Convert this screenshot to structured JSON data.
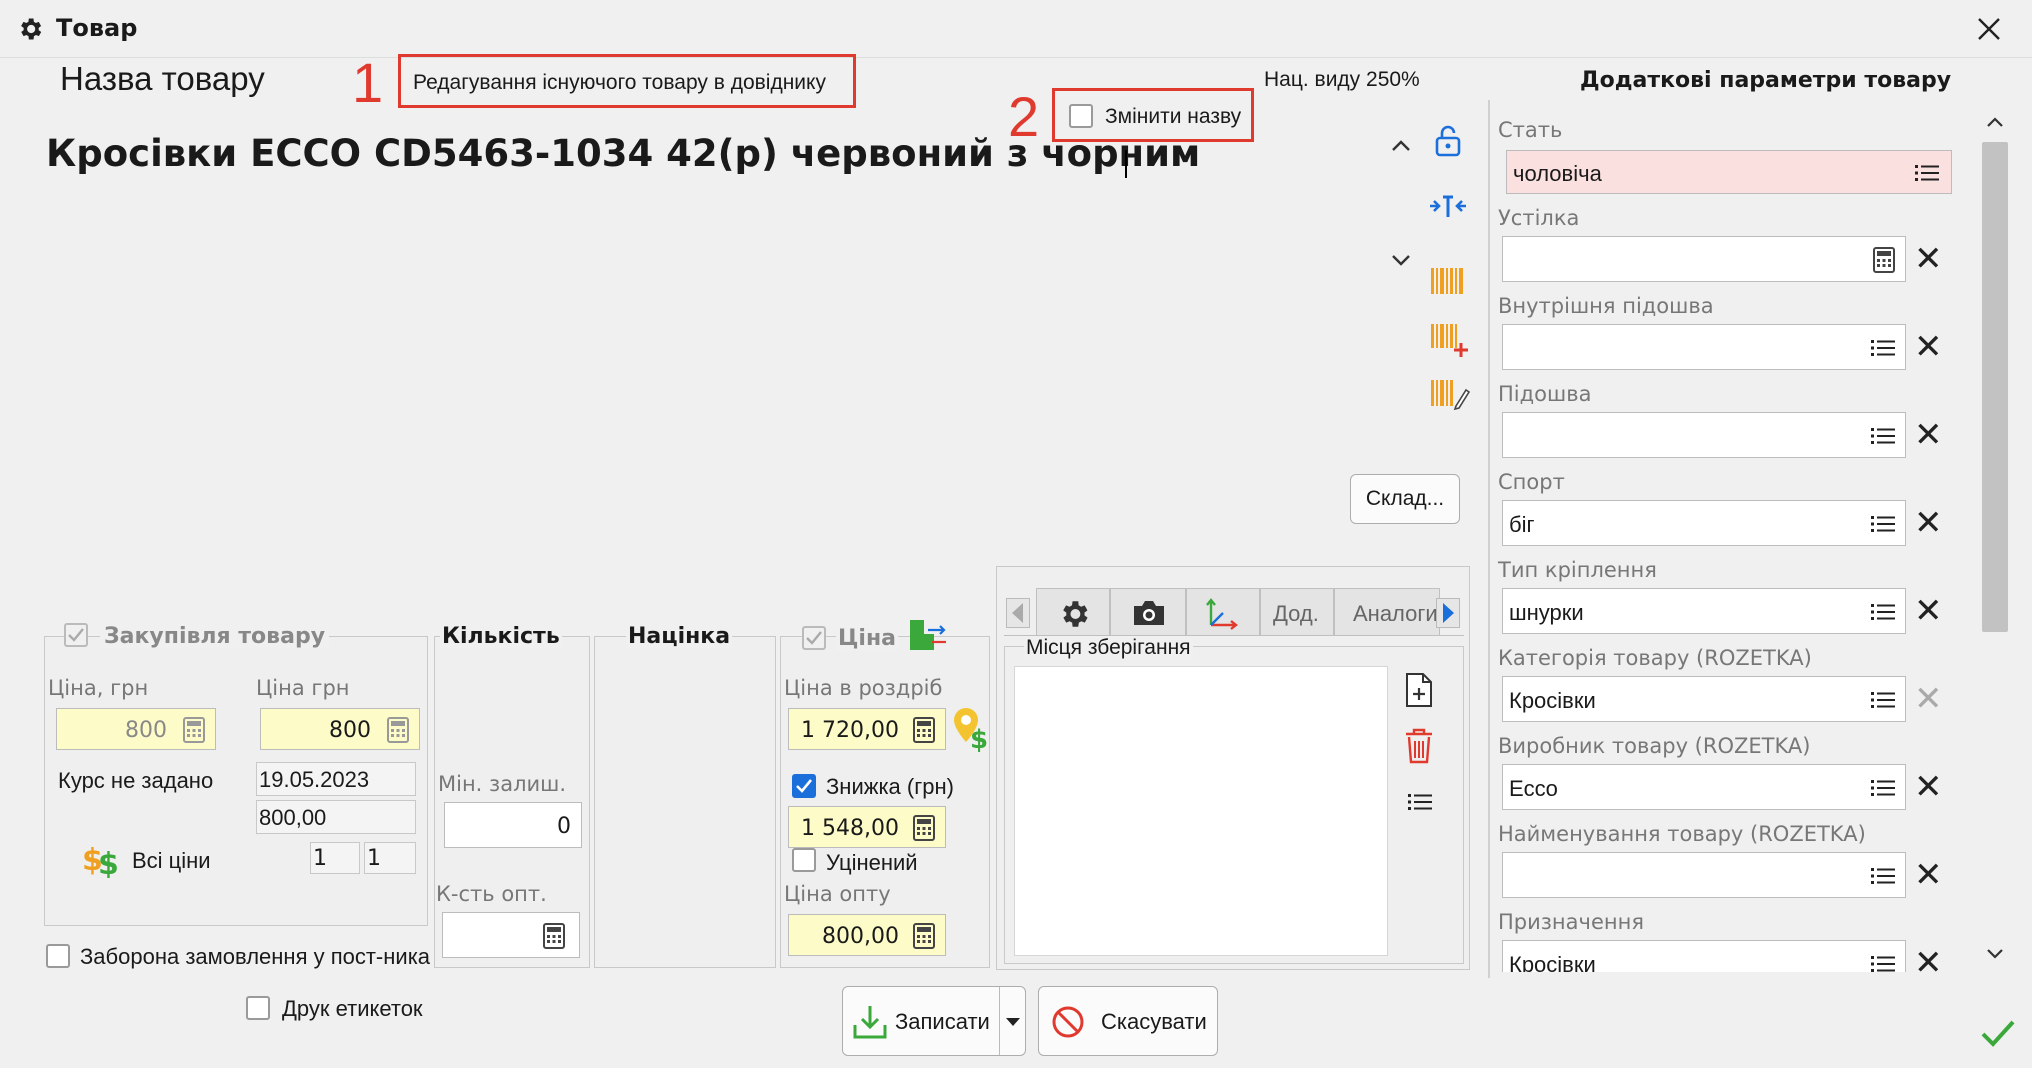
{
  "window": {
    "title": "Товар",
    "close_icon": "close-icon",
    "settings_icon": "gear-icon"
  },
  "header": {
    "name_label": "Назва товару",
    "mode_text": "Редагування існуючого товару в довіднику",
    "markup_text": "Нац. виду 250%",
    "rename_label": "Змінити назву",
    "annot1": "1",
    "annot2": "2",
    "product_name": "Кросівки ECCO CD5463-1034 42(р) червоний з чорним"
  },
  "stock_button": "Склад...",
  "purchase": {
    "title": "Закупівля товару",
    "price_label_1": "Ціна, грн",
    "price_label_2": "Ціна грн",
    "price_1": "800",
    "price_2": "800",
    "rate_text": "Курс не задано",
    "date": "19.05.2023",
    "amount": "800,00",
    "all_prices": "Всі ціни",
    "qty_a": "1",
    "qty_b": "1"
  },
  "quantity": {
    "title": "Кількість",
    "min_label": "Мін. залиш.",
    "min_value": "0",
    "wholesale_qty_label": "К-сть опт."
  },
  "markup": {
    "title": "Націнка"
  },
  "price": {
    "title": "Ціна",
    "retail_label": "Ціна в роздріб",
    "retail_value": "1 720,00",
    "discount_label": "Знижка (грн)",
    "discount_value": "1 548,00",
    "discounted_label": "Уцінений",
    "wholesale_label": "Ціна опту",
    "wholesale_value": "800,00"
  },
  "tabs": {
    "items": [
      "Дод.",
      "Аналоги"
    ],
    "storage_title": "Місця зберігання"
  },
  "bottom": {
    "no_order_label": "Заборона замовлення у пост-ника",
    "print_labels": "Друк етикеток",
    "save_button": "Записати",
    "cancel_button": "Скасувати"
  },
  "params": {
    "title": "Додаткові параметри товару",
    "fields": [
      {
        "label": "Стать",
        "value": "чоловіча"
      },
      {
        "label": "Устілка",
        "value": ""
      },
      {
        "label": "Внутрішня підошва",
        "value": ""
      },
      {
        "label": "Підошва",
        "value": ""
      },
      {
        "label": "Спорт",
        "value": "біг"
      },
      {
        "label": "Тип кріплення",
        "value": "шнурки"
      },
      {
        "label": "Категорія товару (ROZETKA)",
        "value": "Кросівки"
      },
      {
        "label": "Виробник товару (ROZETKA)",
        "value": "Ecco"
      },
      {
        "label": "Найменування товару (ROZETKA)",
        "value": ""
      },
      {
        "label": "Призначення",
        "value": "Кросівки"
      }
    ]
  },
  "colors": {
    "accent": "#1b6fdb",
    "annotation": "#e03a2f",
    "highlight_yellow": "#fdfcc8",
    "required_pink": "#fbe0e0",
    "barcode_orange": "#f0a020",
    "ok_green": "#3aa83a"
  }
}
